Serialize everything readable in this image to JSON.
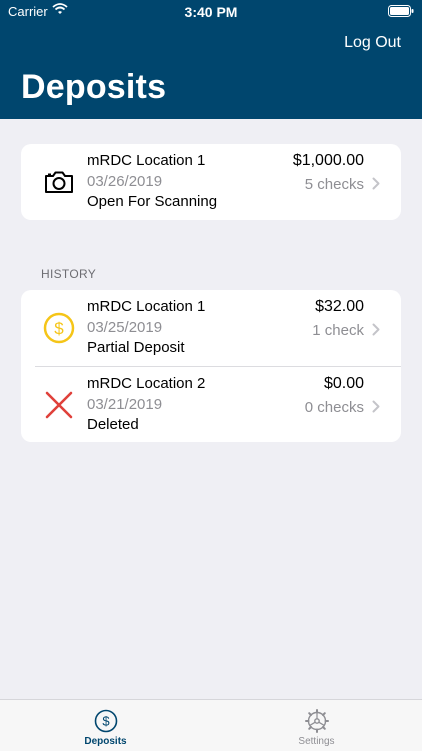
{
  "status_bar": {
    "carrier": "Carrier",
    "time": "3:40 PM"
  },
  "header": {
    "logout_label": "Log Out",
    "title": "Deposits"
  },
  "current_deposit": {
    "location": "mRDC Location 1",
    "date": "03/26/2019",
    "status": "Open For Scanning",
    "amount": "$1,000.00",
    "checks": "5 checks",
    "icon": "camera-icon"
  },
  "history": {
    "label": "HISTORY",
    "items": [
      {
        "location": "mRDC Location 1",
        "date": "03/25/2019",
        "status": "Partial Deposit",
        "amount": "$32.00",
        "checks": "1 check",
        "icon": "dollar-coin-icon"
      },
      {
        "location": "mRDC Location 2",
        "date": "03/21/2019",
        "status": "Deleted",
        "amount": "$0.00",
        "checks": "0 checks",
        "icon": "x-icon"
      }
    ]
  },
  "tabbar": {
    "deposits_label": "Deposits",
    "settings_label": "Settings"
  },
  "colors": {
    "header": "#00466e",
    "accent": "#00466e",
    "coin": "#f5c518",
    "delete": "#e0403a"
  }
}
